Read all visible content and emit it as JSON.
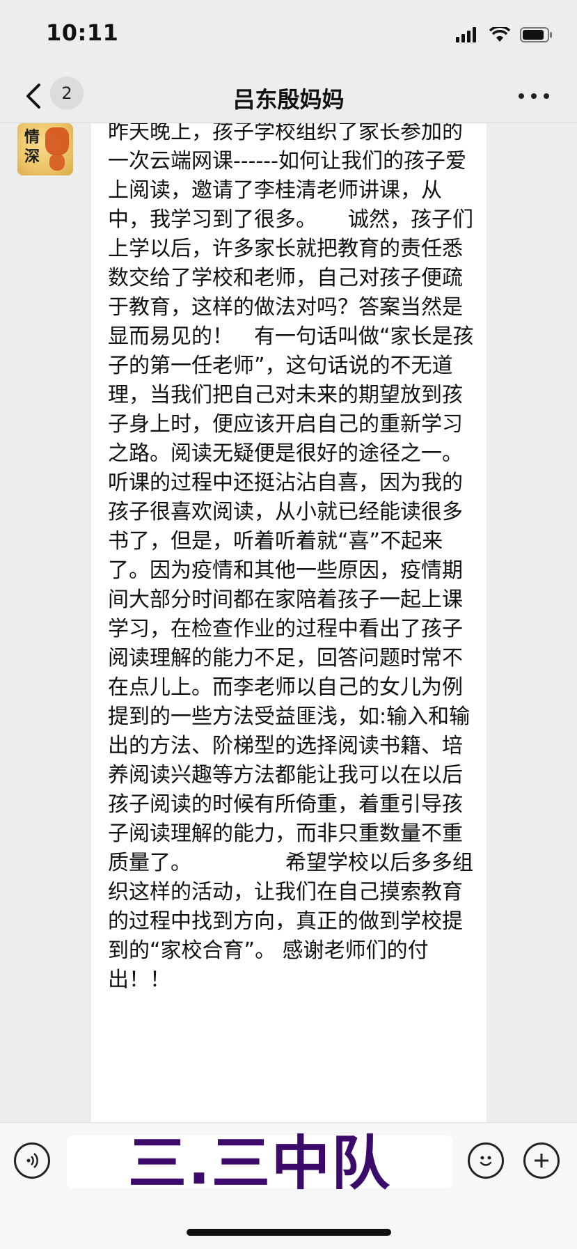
{
  "status_bar": {
    "time": "10:11",
    "icons": [
      "cellular-signal-icon",
      "wifi-icon",
      "battery-icon"
    ]
  },
  "nav": {
    "back_icon": "chevron-left-icon",
    "unread_count": "2",
    "title": "吕东殷妈妈",
    "more_icon": "more-horizontal-icon"
  },
  "message": {
    "avatar_text": "情深",
    "text": "昨天晚上，孩子学校组织了家长参加的一次云端网课------如何让我们的孩子爱上阅读，邀请了李桂清老师讲课，从中，我学习到了很多。　　诚然，孩子们上学以后，许多家长就把教育的责任悉数交给了学校和老师，自己对孩子便疏于教育，这样的做法对吗？答案当然是显而易见的！　有一句话叫做“家长是孩子的第一任老师”，这句话说的不无道理，当我们把自己对未来的期望放到孩子身上时，便应该开启自己的重新学习之路。阅读无疑便是很好的途径之一。　　　听课的过程中还挺沾沾自喜，因为我的孩子很喜欢阅读，从小就已经能读很多书了，但是，听着听着就“喜”不起来了。因为疫情和其他一些原因，疫情期间大部分时间都在家陪着孩子一起上课学习，在检查作业的过程中看出了孩子阅读理解的能力不足，回答问题时常不在点儿上。而李老师以自己的女儿为例提到的一些方法受益匪浅，如:输入和输出的方法、阶梯型的选择阅读书籍、培养阅读兴趣等方法都能让我可以在以后孩子阅读的时候有所倚重，着重引导孩子阅读理解的能力，而非只重数量不重质量了。　　　　　希望学校以后多多组织这样的活动，让我们在自己摸索教育的过程中找到方向，真正的做到学校提到的“家校合育”。 感谢老师们的付出！！"
  },
  "input_bar": {
    "voice_icon": "voice-icon",
    "overlay_text": "三.三中队",
    "emoji_icon": "emoji-icon",
    "plus_icon": "plus-icon"
  }
}
